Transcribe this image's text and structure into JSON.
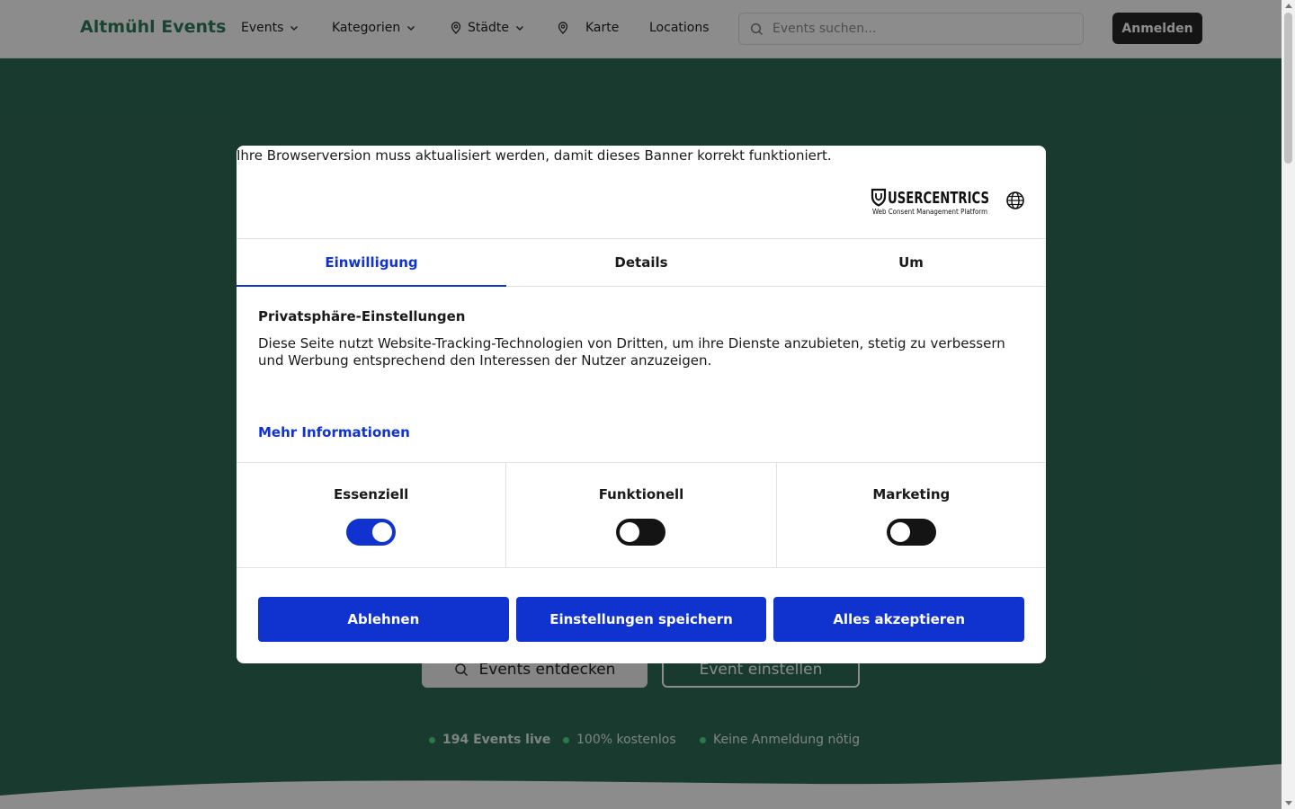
{
  "nav": {
    "brand": "Altmühl Events",
    "items": [
      {
        "label": "Events"
      },
      {
        "label": "Kategorien"
      },
      {
        "label": "Städte"
      },
      {
        "label": "Karte"
      },
      {
        "label": "Locations"
      }
    ],
    "search_placeholder": "Events suchen...",
    "login_label": "Anmelden"
  },
  "hero": {
    "discover_label": "Events entdecken",
    "submit_label": "Event einstellen",
    "stats": [
      {
        "label": "194 Events live"
      },
      {
        "label": "100% kostenlos"
      },
      {
        "label": "Keine Anmeldung nötig"
      }
    ]
  },
  "consent": {
    "browser_warning": "Ihre Browserversion muss aktualisiert werden, damit dieses Banner korrekt funktioniert.",
    "logo_text": "USERCENTRICS",
    "logo_subtext": "Web Consent Management Platform",
    "tabs": [
      {
        "label": "Einwilligung"
      },
      {
        "label": "Details"
      },
      {
        "label": "Um"
      }
    ],
    "title": "Privatsphäre-Einstellungen",
    "description": "Diese Seite nutzt Website-Tracking-Technologien von Dritten, um ihre Dienste anzubieten, stetig zu verbessern und Werbung entsprechend den Interessen der Nutzer anzuzeigen.",
    "more_info": "Mehr Informationen",
    "categories": [
      {
        "label": "Essenziell",
        "enabled": true
      },
      {
        "label": "Funktionell",
        "enabled": false
      },
      {
        "label": "Marketing",
        "enabled": false
      }
    ],
    "buttons": {
      "deny": "Ablehnen",
      "save": "Einstellungen speichern",
      "accept_all": "Alles akzeptieren"
    }
  },
  "colors": {
    "brand_green": "#2e7d5b",
    "hero_bg": "#2f6a57",
    "consent_blue": "#1032cf"
  }
}
